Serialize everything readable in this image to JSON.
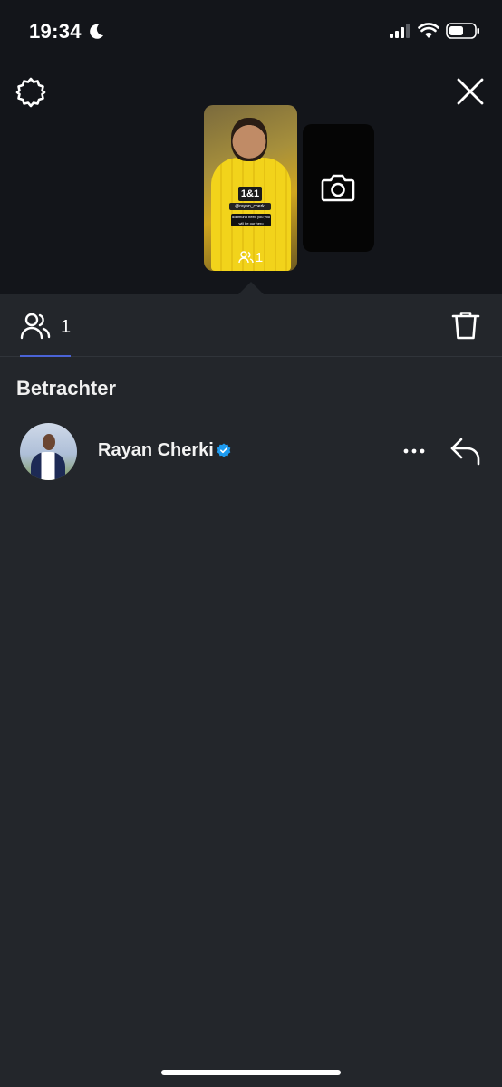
{
  "status_bar": {
    "time": "19:34",
    "icons": [
      "moon-icon",
      "signal-icon",
      "wifi-icon",
      "battery-icon"
    ]
  },
  "header": {
    "settings_icon": "gear-icon",
    "close_icon": "close-icon"
  },
  "story": {
    "thumb_sponsor": "1&1",
    "thumb_tag": "@rayan_cherki",
    "thumb_caption": "dortmund need you you will be our hero",
    "viewer_count": "1",
    "camera_icon": "camera-icon"
  },
  "tabs": {
    "viewers_count": "1",
    "delete_icon": "trash-icon"
  },
  "section": {
    "title": "Betrachter"
  },
  "viewers": [
    {
      "name": "Rayan Cherki",
      "verified": true
    }
  ],
  "colors": {
    "background": "#23262b",
    "top_background": "#13151a",
    "accent": "#4a63d6",
    "verified": "#1d9bf0"
  }
}
